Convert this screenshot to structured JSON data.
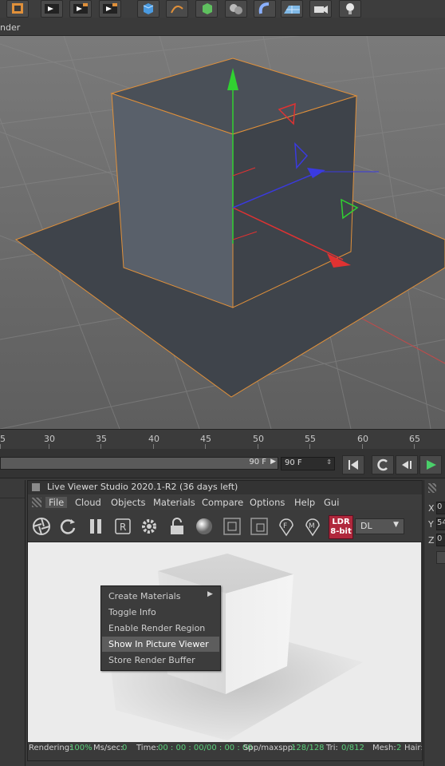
{
  "toolbar": {
    "view_menu_label": "nder"
  },
  "timeline": {
    "ticks": [
      "5",
      "30",
      "35",
      "40",
      "45",
      "50",
      "55",
      "60",
      "65"
    ],
    "end_frame_slider": "90 F",
    "end_frame_field": "90 F"
  },
  "live_viewer": {
    "title": "Live Viewer Studio 2020.1-R2 (36 days left)",
    "menu": [
      "File",
      "Cloud",
      "Objects",
      "Materials",
      "Compare",
      "Options",
      "Help",
      "Gui"
    ],
    "toolbar": {
      "ldr_badge_line1": "LDR",
      "ldr_badge_line2": "8-bit",
      "mode_select": "DL",
      "region_label": "R",
      "pin_f_label": "F",
      "pin_m_label": "M"
    },
    "context_menu": {
      "items": [
        "Create Materials",
        "Toggle Info",
        "Enable Render Region",
        "Show In Picture Viewer",
        "Store Render Buffer"
      ],
      "highlighted_index": 3
    },
    "status": {
      "rendering_label": "Rendering:",
      "rendering_value": "100%",
      "mssec_label": "Ms/sec:",
      "mssec_value": "0",
      "time_label": "Time:",
      "time_value": "00 : 00 : 00/00 : 00 : 00",
      "spp_label": "Spp/maxspp:",
      "spp_value": "128/128",
      "tri_label": "Tri:",
      "tri_value": "0/812",
      "mesh_label": "Mesh:",
      "mesh_value": "2",
      "hair_label": "Hair:"
    }
  },
  "attributes": {
    "x_label": "X",
    "x_value": "0",
    "y_label": "Y",
    "y_value": "54",
    "z_label": "Z",
    "z_value": "0"
  },
  "colors": {
    "accent_green": "#5ad07a",
    "selection_orange": "#e0903a",
    "ldr_badge": "#b0283c"
  }
}
